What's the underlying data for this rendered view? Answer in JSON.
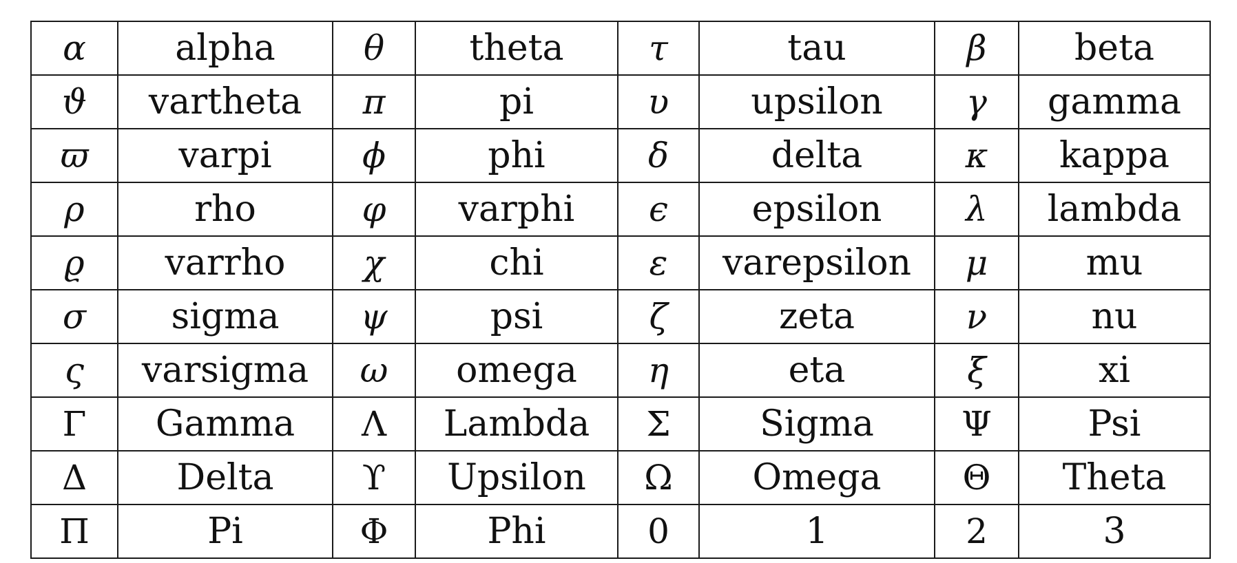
{
  "table": {
    "rows": [
      [
        {
          "symbol": "α",
          "name": "alpha"
        },
        {
          "symbol": "θ",
          "name": "theta"
        },
        {
          "symbol": "τ",
          "name": "tau"
        },
        {
          "symbol": "β",
          "name": "beta"
        }
      ],
      [
        {
          "symbol": "ϑ",
          "name": "vartheta"
        },
        {
          "symbol": "π",
          "name": "pi"
        },
        {
          "symbol": "υ",
          "name": "upsilon"
        },
        {
          "symbol": "γ",
          "name": "gamma"
        }
      ],
      [
        {
          "symbol": "ϖ",
          "name": "varpi"
        },
        {
          "symbol": "ϕ",
          "name": "phi"
        },
        {
          "symbol": "δ",
          "name": "delta"
        },
        {
          "symbol": "κ",
          "name": "kappa"
        }
      ],
      [
        {
          "symbol": "ρ",
          "name": "rho"
        },
        {
          "symbol": "φ",
          "name": "varphi"
        },
        {
          "symbol": "ϵ",
          "name": "epsilon"
        },
        {
          "symbol": "λ",
          "name": "lambda"
        }
      ],
      [
        {
          "symbol": "ϱ",
          "name": "varrho"
        },
        {
          "symbol": "χ",
          "name": "chi"
        },
        {
          "symbol": "ε",
          "name": "varepsilon"
        },
        {
          "symbol": "μ",
          "name": "mu"
        }
      ],
      [
        {
          "symbol": "σ",
          "name": "sigma"
        },
        {
          "symbol": "ψ",
          "name": "psi"
        },
        {
          "symbol": "ζ",
          "name": "zeta"
        },
        {
          "symbol": "ν",
          "name": "nu"
        }
      ],
      [
        {
          "symbol": "ς",
          "name": "varsigma"
        },
        {
          "symbol": "ω",
          "name": "omega"
        },
        {
          "symbol": "η",
          "name": "eta"
        },
        {
          "symbol": "ξ",
          "name": "xi"
        }
      ],
      [
        {
          "symbol": "Γ",
          "name": "Gamma"
        },
        {
          "symbol": "Λ",
          "name": "Lambda"
        },
        {
          "symbol": "Σ",
          "name": "Sigma"
        },
        {
          "symbol": "Ψ",
          "name": "Psi"
        }
      ],
      [
        {
          "symbol": "Δ",
          "name": "Delta"
        },
        {
          "symbol": "ϒ",
          "name": "Upsilon"
        },
        {
          "symbol": "Ω",
          "name": "Omega"
        },
        {
          "symbol": "Θ",
          "name": "Theta"
        }
      ],
      [
        {
          "symbol": "Π",
          "name": "Pi"
        },
        {
          "symbol": "Φ",
          "name": "Phi"
        },
        {
          "symbol": "0",
          "name": "1"
        },
        {
          "symbol": "2",
          "name": "3"
        }
      ]
    ]
  }
}
